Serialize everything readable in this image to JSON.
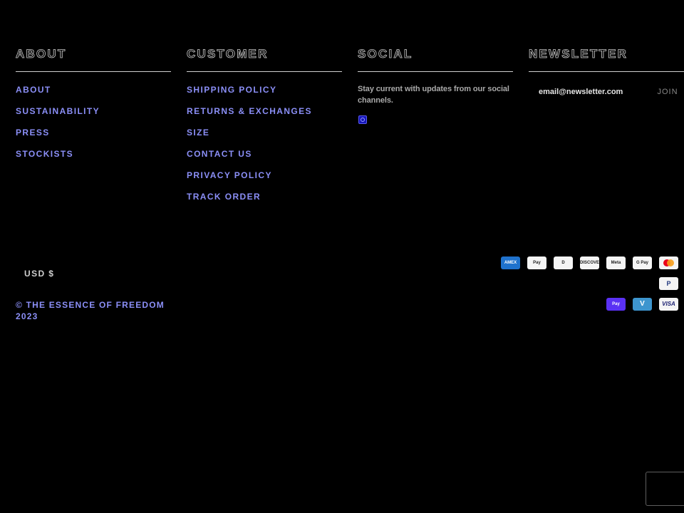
{
  "footer": {
    "about": {
      "heading": "ABOUT",
      "links": [
        "ABOUT",
        "SUSTAINABILITY",
        "PRESS",
        "STOCKISTS"
      ]
    },
    "customer": {
      "heading": "CUSTOMER",
      "links": [
        "SHIPPING POLICY",
        "RETURNS & EXCHANGES",
        "SIZE",
        "CONTACT US",
        "PRIVACY POLICY",
        "TRACK ORDER"
      ]
    },
    "social": {
      "heading": "SOCIAL",
      "text": "Stay current with updates from our social channels.",
      "icon": "instagram-icon"
    },
    "newsletter": {
      "heading": "NEWSLETTER",
      "placeholder": "email@newsletter.com",
      "button": "JOIN"
    }
  },
  "currency": "USD $",
  "copyright": "© THE ESSENCE OF FREEDOM 2023",
  "payment_methods": [
    {
      "name": "American Express",
      "label": "AMEX"
    },
    {
      "name": "Apple Pay",
      "label": "Pay"
    },
    {
      "name": "Diners Club",
      "label": "D"
    },
    {
      "name": "Discover",
      "label": "DISCOVER"
    },
    {
      "name": "Meta Pay",
      "label": "Meta"
    },
    {
      "name": "Google Pay",
      "label": "G Pay"
    },
    {
      "name": "Mastercard",
      "label": ""
    },
    {
      "name": "PayPal",
      "label": "P"
    },
    {
      "name": "Shop Pay",
      "label": "Pay"
    },
    {
      "name": "Venmo",
      "label": "V"
    },
    {
      "name": "Visa",
      "label": "VISA"
    }
  ],
  "colors": {
    "background": "#000000",
    "link": "#8b8ff7",
    "heading_outline": "#d0d0d0"
  }
}
